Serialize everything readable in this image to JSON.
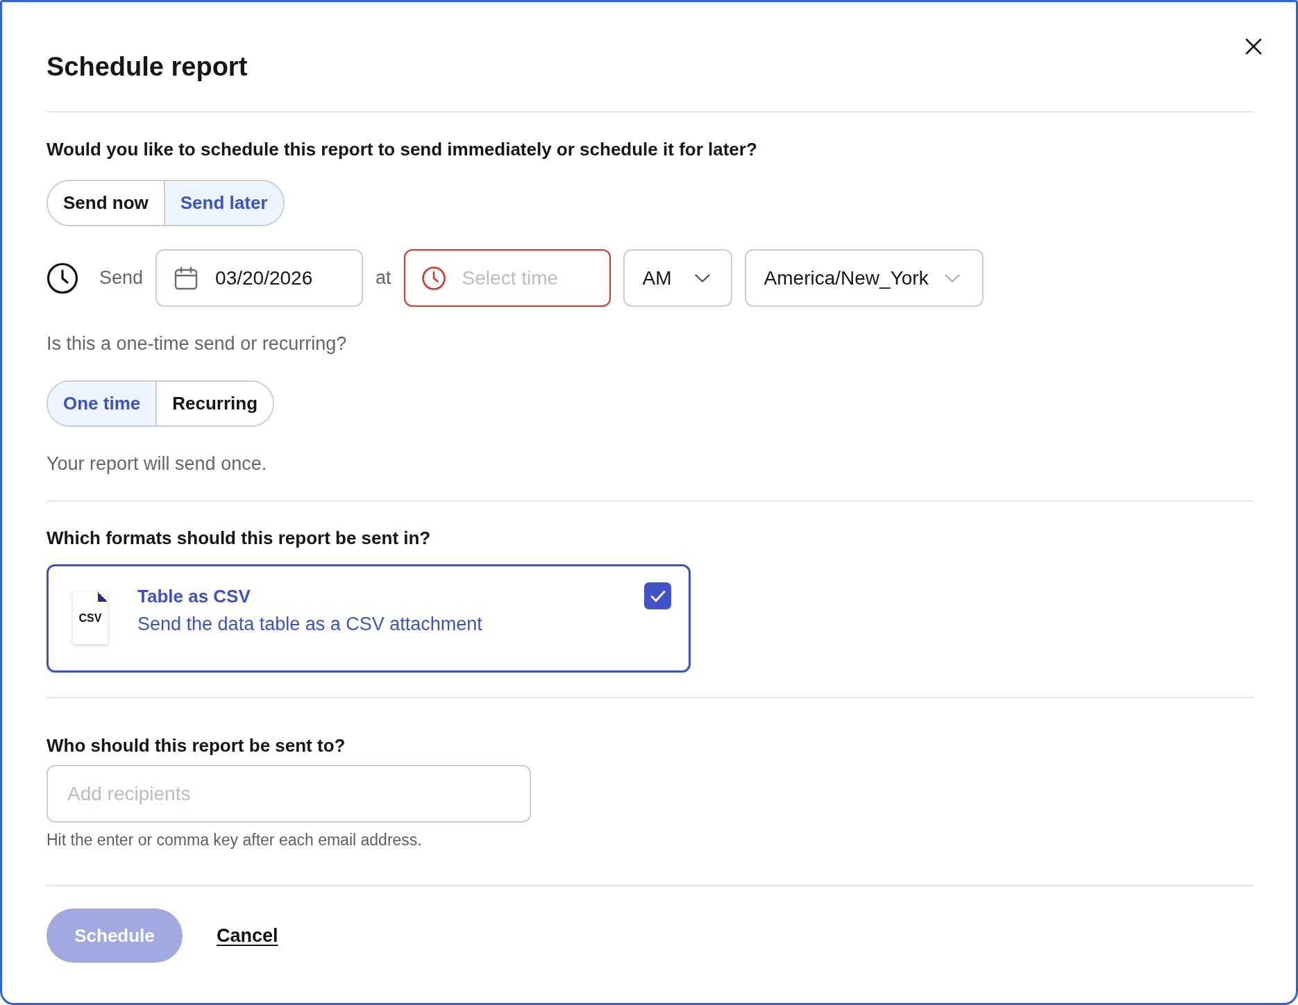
{
  "dialog": {
    "title": "Schedule report"
  },
  "timing": {
    "question": "Would you like to schedule this report to send immediately or schedule it for later?",
    "options": [
      {
        "label": "Send now",
        "selected": false
      },
      {
        "label": "Send later",
        "selected": true
      }
    ]
  },
  "send_row": {
    "label": "Send",
    "date": {
      "value": "03/20/2026"
    },
    "connector": "at",
    "time": {
      "placeholder": "Select time",
      "invalid": true
    },
    "period": {
      "value": "AM"
    },
    "timezone": {
      "value": "America/New_York"
    }
  },
  "frequency": {
    "question": "Is this a one-time send or recurring?",
    "options": [
      {
        "label": "One time",
        "selected": true
      },
      {
        "label": "Recurring",
        "selected": false
      }
    ],
    "summary": "Your report will send once."
  },
  "formats": {
    "question": "Which formats should this report be sent in?",
    "items": [
      {
        "badge": "CSV",
        "title": "Table as CSV",
        "description": "Send the data table as a CSV attachment",
        "checked": true
      }
    ]
  },
  "recipients": {
    "question": "Who should this report be sent to?",
    "placeholder": "Add recipients",
    "hint": "Hit the enter or comma key after each email address."
  },
  "actions": {
    "primary": {
      "label": "Schedule",
      "disabled": true
    },
    "cancel": "Cancel"
  }
}
